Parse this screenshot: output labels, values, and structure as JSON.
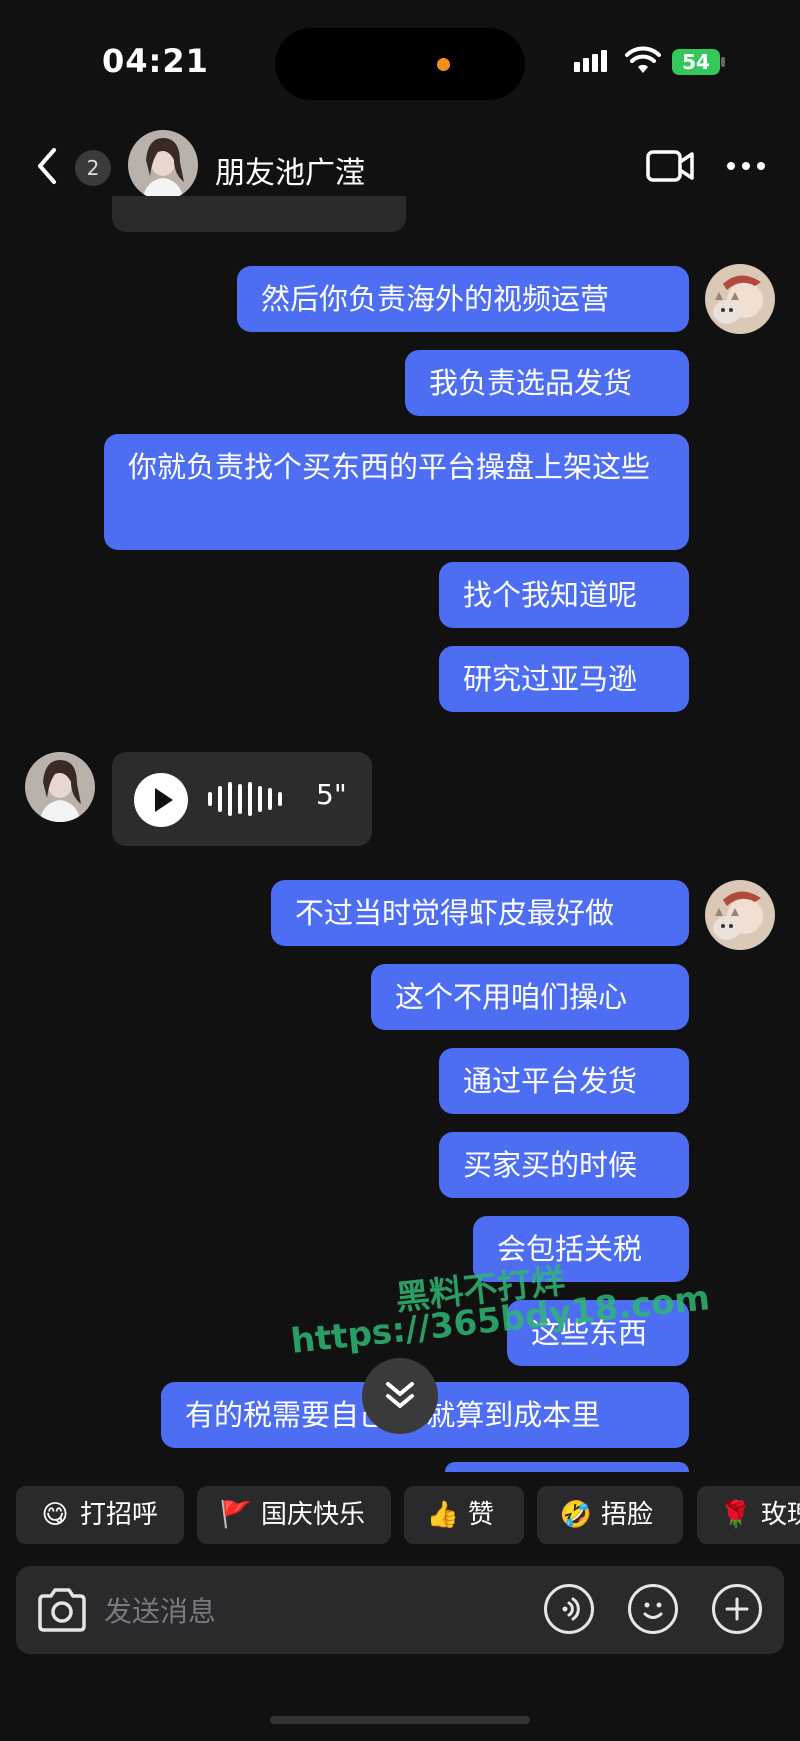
{
  "status_bar": {
    "time": "04:21",
    "battery": "54",
    "recording_dot_color": "#f39019"
  },
  "header": {
    "unread_count": "2",
    "contact_name": "朋友池广滢",
    "back_icon": "chevron-left-icon",
    "video_icon": "video-camera-icon",
    "more_icon": "more-horizontal-icon"
  },
  "messages": [
    {
      "sender": "me",
      "text": "然后你负责海外的视频运营"
    },
    {
      "sender": "me",
      "text": "我负责选品发货"
    },
    {
      "sender": "me",
      "text": "你就负责找个买东西的平台操盘上架这些"
    },
    {
      "sender": "me",
      "text": "找个我知道呢"
    },
    {
      "sender": "me",
      "text": "研究过亚马逊"
    },
    {
      "sender": "other",
      "type": "voice",
      "duration": "5\""
    },
    {
      "sender": "me",
      "text": "不过当时觉得虾皮最好做"
    },
    {
      "sender": "me",
      "text": "这个不用咱们操心"
    },
    {
      "sender": "me",
      "text": "通过平台发货"
    },
    {
      "sender": "me",
      "text": "买家买的时候"
    },
    {
      "sender": "me",
      "text": "会包括关税"
    },
    {
      "sender": "me",
      "text": "这些东西"
    },
    {
      "sender": "me",
      "text": "有的税需要自己掏 就算到成本里"
    }
  ],
  "watermark": {
    "line1": "黑料不打烊",
    "line2": "https://365bdy18.com"
  },
  "quick_replies": [
    {
      "emoji": "😋",
      "label": "打招呼"
    },
    {
      "emoji": "🚩",
      "label": "国庆快乐"
    },
    {
      "emoji": "👍",
      "label": "赞"
    },
    {
      "emoji": "🤣",
      "label": "捂脸"
    },
    {
      "emoji": "🌹",
      "label": "玫瑰"
    }
  ],
  "input": {
    "placeholder": "发送消息"
  },
  "colors": {
    "bubble_me": "#4d6ef3",
    "bubble_other": "#2c2c2e",
    "background": "#111111",
    "watermark": "#2fb673"
  }
}
